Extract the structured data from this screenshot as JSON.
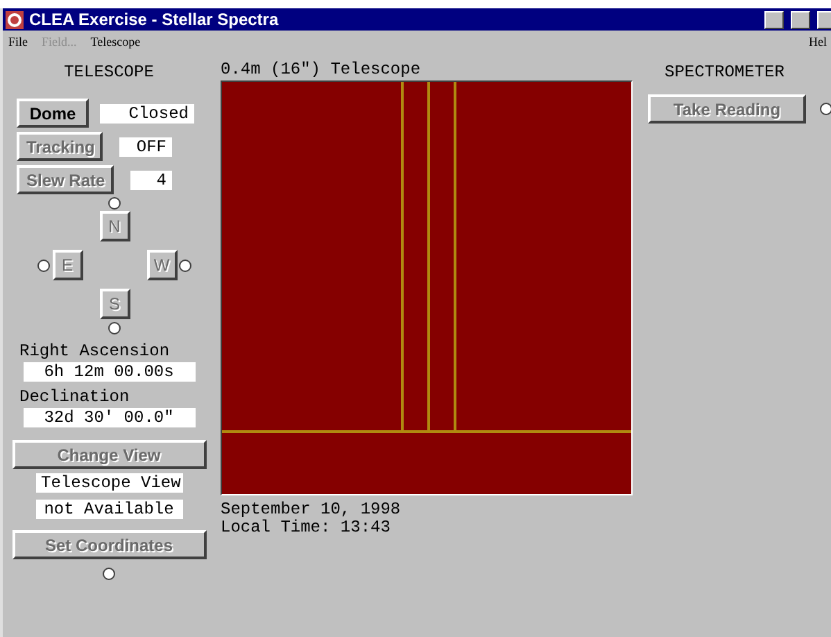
{
  "window": {
    "title": "CLEA Exercise - Stellar Spectra"
  },
  "menu": [
    {
      "label": "File",
      "disabled": false
    },
    {
      "label": "Field...",
      "disabled": true
    },
    {
      "label": "Telescope",
      "disabled": false
    }
  ],
  "help_menu": "Hel",
  "telescope": {
    "heading": "TELESCOPE",
    "controls": [
      {
        "label": "Dome",
        "disabled": false,
        "value": "Closed"
      },
      {
        "label": "Tracking",
        "disabled": true,
        "value": "OFF"
      },
      {
        "label": "Slew Rate",
        "disabled": true,
        "value": "4"
      }
    ],
    "directions": {
      "north": {
        "label": "N",
        "disabled": true
      },
      "east": {
        "label": "E",
        "disabled": true
      },
      "west": {
        "label": "W",
        "disabled": true
      },
      "south": {
        "label": "S",
        "disabled": true
      }
    },
    "ra_label": "Right Ascension",
    "ra_value": "6h 12m 00.00s",
    "dec_label": "Declination",
    "dec_value": "32d 30' 00.0\"",
    "change_view": {
      "label": "Change View",
      "disabled": true
    },
    "view_status": [
      "Telescope View",
      "not Available"
    ],
    "set_coordinates": {
      "label": "Set Coordinates",
      "disabled": true
    }
  },
  "view": {
    "title": "0.4m (16\") Telescope",
    "date": "September 10, 1998",
    "local_time": "Local Time: 13:43"
  },
  "spectrometer": {
    "heading": "SPECTROMETER",
    "take_reading": {
      "label": "Take Reading",
      "disabled": true
    }
  }
}
